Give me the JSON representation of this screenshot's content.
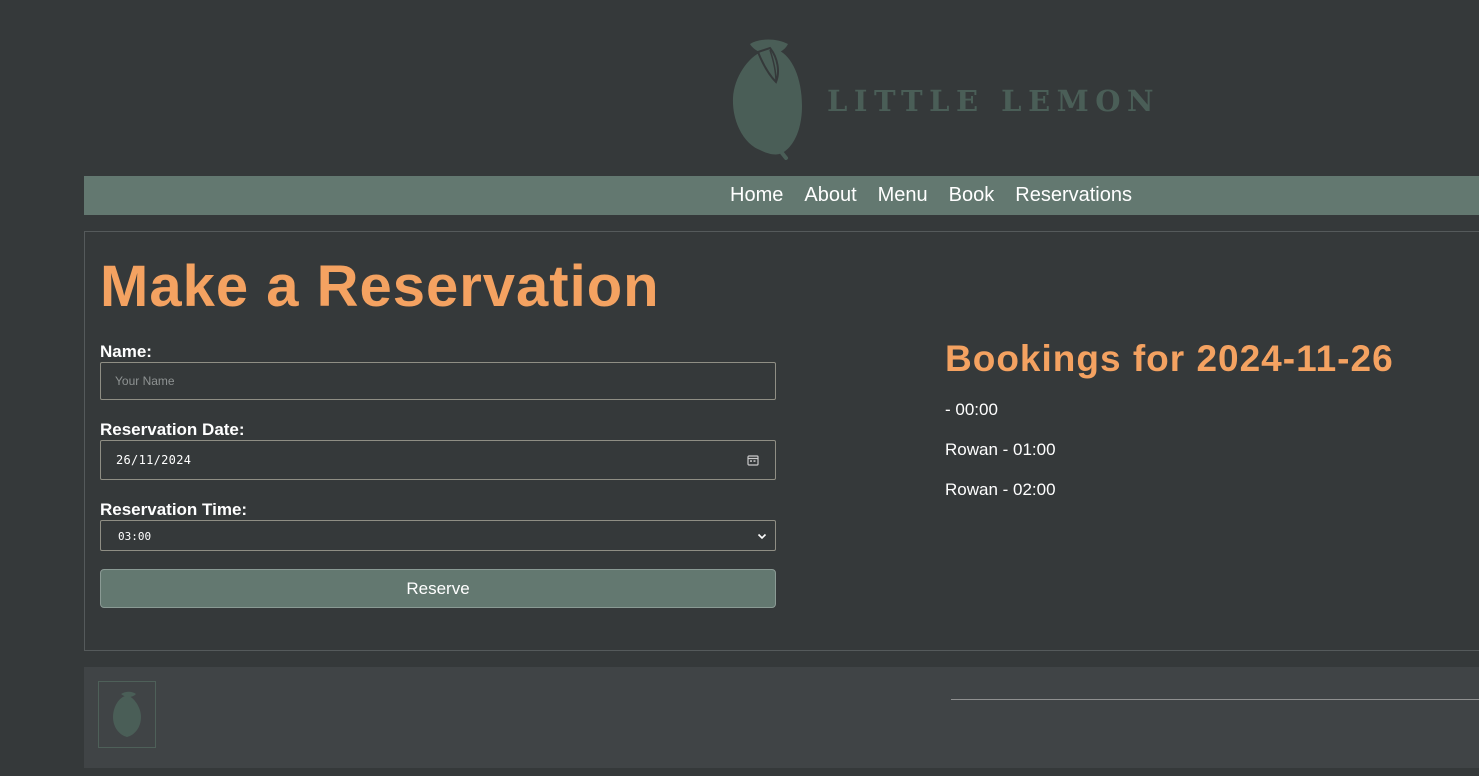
{
  "header": {
    "logo_text": "LITTLE LEMON"
  },
  "nav": {
    "items": [
      {
        "label": "Home"
      },
      {
        "label": "About"
      },
      {
        "label": "Menu"
      },
      {
        "label": "Book"
      },
      {
        "label": "Reservations"
      }
    ]
  },
  "form": {
    "title": "Make a Reservation",
    "name_label": "Name:",
    "name_placeholder": "Your Name",
    "name_value": "",
    "date_label": "Reservation Date:",
    "date_value": "26/11/2024",
    "time_label": "Reservation Time:",
    "time_value": "03:00",
    "submit_label": "Reserve"
  },
  "bookings": {
    "title": "Bookings for 2024-11-26",
    "items": [
      {
        "text": "- 00:00"
      },
      {
        "text": "Rowan - 01:00"
      },
      {
        "text": "Rowan - 02:00"
      }
    ]
  },
  "colors": {
    "background": "#35393a",
    "nav_background": "#637870",
    "accent": "#f4a261",
    "logo": "#4a5e57",
    "footer_background": "#404446"
  },
  "icons": {
    "logo": "lemon-icon",
    "date_picker": "calendar-icon",
    "select": "chevron-down-icon"
  }
}
